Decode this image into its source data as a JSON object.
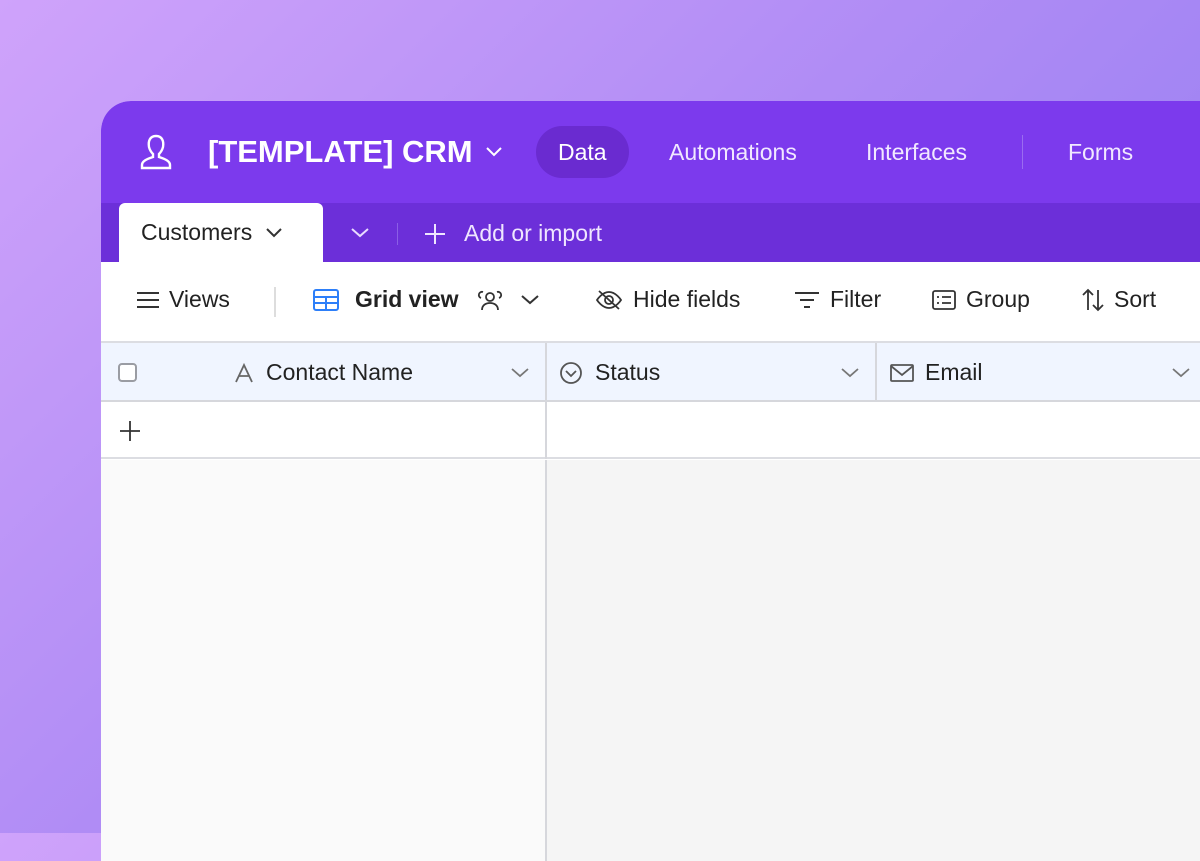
{
  "app": {
    "base_title": "[TEMPLATE] CRM",
    "nav": [
      {
        "label": "Data",
        "active": true
      },
      {
        "label": "Automations"
      },
      {
        "label": "Interfaces"
      },
      {
        "label": "Forms"
      }
    ]
  },
  "tabs": {
    "active": "Customers",
    "add_label": "Add or import"
  },
  "toolbar": {
    "views": "Views",
    "view_name": "Grid view",
    "hide_fields": "Hide fields",
    "filter": "Filter",
    "group": "Group",
    "sort": "Sort"
  },
  "columns": [
    {
      "label": "Contact Name",
      "icon": "text-icon"
    },
    {
      "label": "Status",
      "icon": "single-select-icon"
    },
    {
      "label": "Email",
      "icon": "email-icon"
    }
  ],
  "colors": {
    "header": "#7c3aed",
    "tabbar": "#6c2fd9",
    "grid_icon": "#2d7ff9"
  }
}
